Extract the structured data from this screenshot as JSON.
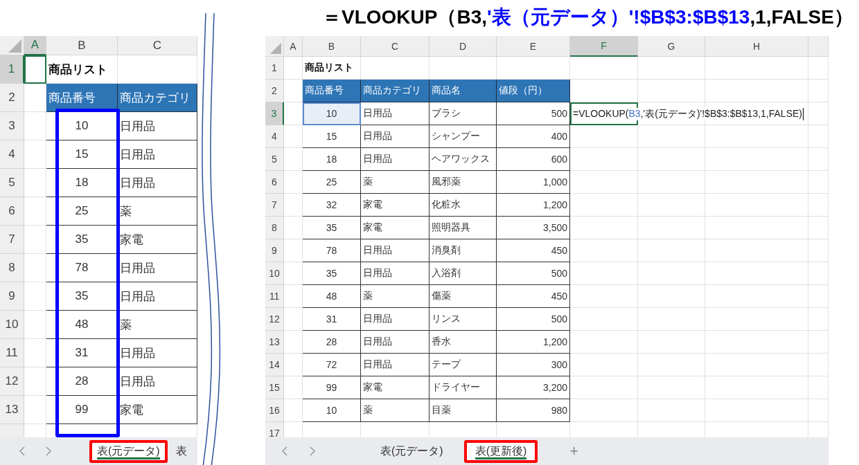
{
  "left_sheet": {
    "columns": [
      {
        "label": "A",
        "selected": true
      },
      {
        "label": "B",
        "selected": false
      },
      {
        "label": "C",
        "selected": false
      }
    ],
    "title_row": {
      "number": "1",
      "title": "商品リスト",
      "selected": true
    },
    "header_row": {
      "number": "2",
      "labels": [
        "商品番号",
        "商品カテゴリ"
      ]
    },
    "rows": [
      {
        "number": "3",
        "id": "10",
        "category": "日用品"
      },
      {
        "number": "4",
        "id": "15",
        "category": "日用品"
      },
      {
        "number": "5",
        "id": "18",
        "category": "日用品"
      },
      {
        "number": "6",
        "id": "25",
        "category": "薬"
      },
      {
        "number": "7",
        "id": "35",
        "category": "家電"
      },
      {
        "number": "8",
        "id": "78",
        "category": "日用品"
      },
      {
        "number": "9",
        "id": "35",
        "category": "日用品"
      },
      {
        "number": "10",
        "id": "48",
        "category": "薬"
      },
      {
        "number": "11",
        "id": "31",
        "category": "日用品"
      },
      {
        "number": "12",
        "id": "28",
        "category": "日用品"
      },
      {
        "number": "13",
        "id": "99",
        "category": "家電"
      }
    ],
    "tabs": [
      {
        "label": "表(元データ)",
        "selected": true
      },
      {
        "label": "表",
        "selected": false
      }
    ]
  },
  "caption": {
    "parts": [
      {
        "text": "＝VLOOKUP（B3,",
        "color": "#000000"
      },
      {
        "text": "'表（元データ）'!$B$3:$B$13",
        "color": "#0000ff"
      },
      {
        "text": ",1,FALSE）",
        "color": "#000000"
      }
    ]
  },
  "right_sheet": {
    "columns": [
      {
        "label": "A",
        "selected": false
      },
      {
        "label": "B",
        "selected": false
      },
      {
        "label": "C",
        "selected": false
      },
      {
        "label": "D",
        "selected": false
      },
      {
        "label": "E",
        "selected": false
      },
      {
        "label": "F",
        "selected": true
      },
      {
        "label": "G",
        "selected": false
      },
      {
        "label": "H",
        "selected": false
      }
    ],
    "title_row": {
      "number": "1",
      "title": "商品リスト"
    },
    "header_row": {
      "number": "2",
      "labels": [
        "商品番号",
        "商品カテゴリ",
        "商品名",
        "値段（円）"
      ]
    },
    "rows": [
      {
        "number": "3",
        "id": "10",
        "category": "日用品",
        "name": "ブラシ",
        "price": "500",
        "selected": true,
        "formula": {
          "parts": [
            {
              "text": "=VLOOKUP(",
              "kind": "plain"
            },
            {
              "text": "B3",
              "kind": "ref"
            },
            {
              "text": ",'表(元データ)'!$B$3:$B$13,1,FALSE)",
              "kind": "plain"
            }
          ]
        }
      },
      {
        "number": "4",
        "id": "15",
        "category": "日用品",
        "name": "シャンプー",
        "price": "400",
        "selected": false
      },
      {
        "number": "5",
        "id": "18",
        "category": "日用品",
        "name": "ヘアワックス",
        "price": "600",
        "selected": false
      },
      {
        "number": "6",
        "id": "25",
        "category": "薬",
        "name": "風邪薬",
        "price": "1,000",
        "selected": false
      },
      {
        "number": "7",
        "id": "32",
        "category": "家電",
        "name": "化粧水",
        "price": "1,200",
        "selected": false
      },
      {
        "number": "8",
        "id": "35",
        "category": "家電",
        "name": "照明器具",
        "price": "3,500",
        "selected": false
      },
      {
        "number": "9",
        "id": "78",
        "category": "日用品",
        "name": "消臭剤",
        "price": "450",
        "selected": false
      },
      {
        "number": "10",
        "id": "35",
        "category": "日用品",
        "name": "入浴剤",
        "price": "500",
        "selected": false
      },
      {
        "number": "11",
        "id": "48",
        "category": "薬",
        "name": "傷薬",
        "price": "450",
        "selected": false
      },
      {
        "number": "12",
        "id": "31",
        "category": "日用品",
        "name": "リンス",
        "price": "500",
        "selected": false
      },
      {
        "number": "13",
        "id": "28",
        "category": "日用品",
        "name": "香水",
        "price": "1,200",
        "selected": false
      },
      {
        "number": "14",
        "id": "72",
        "category": "日用品",
        "name": "テープ",
        "price": "300",
        "selected": false
      },
      {
        "number": "15",
        "id": "99",
        "category": "家電",
        "name": "ドライヤー",
        "price": "3,200",
        "selected": false
      },
      {
        "number": "16",
        "id": "10",
        "category": "薬",
        "name": "目薬",
        "price": "980",
        "selected": false
      }
    ],
    "empty_rows": [
      "17"
    ],
    "tabs": [
      {
        "label": "表(元データ)",
        "selected": false
      },
      {
        "label": "表(更新後)",
        "selected": true
      }
    ],
    "add_tab": "+"
  }
}
